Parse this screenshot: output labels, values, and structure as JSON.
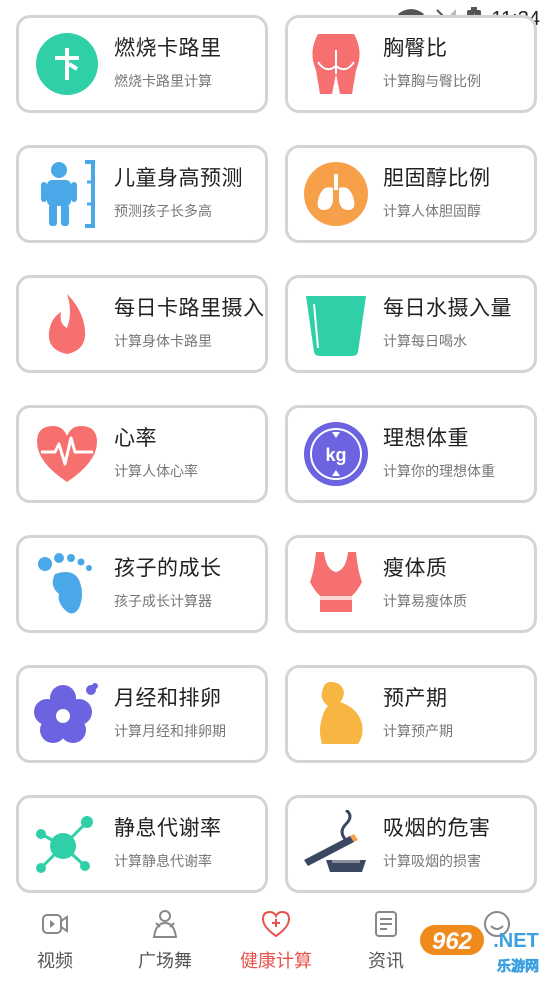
{
  "status_bar": {
    "time": "11:34"
  },
  "cards": [
    {
      "id": "calorie-burn",
      "title": "燃烧卡路里",
      "subtitle": "燃烧卡路里计算",
      "icon": "calorie-card-icon"
    },
    {
      "id": "chest-hip",
      "title": "胸臀比",
      "subtitle": "计算胸与臀比例",
      "icon": "hip-icon"
    },
    {
      "id": "child-height",
      "title": "儿童身高预测",
      "subtitle": "预测孩子长多高",
      "icon": "child-height-icon"
    },
    {
      "id": "cholesterol",
      "title": "胆固醇比例",
      "subtitle": "计算人体胆固醇",
      "icon": "lungs-icon"
    },
    {
      "id": "daily-calorie",
      "title": "每日卡路里摄入",
      "subtitle": "计算身体卡路里",
      "icon": "flame-icon"
    },
    {
      "id": "daily-water",
      "title": "每日水摄入量",
      "subtitle": "计算每日喝水",
      "icon": "water-glass-icon"
    },
    {
      "id": "heart-rate",
      "title": "心率",
      "subtitle": "计算人体心率",
      "icon": "heart-pulse-icon"
    },
    {
      "id": "ideal-weight",
      "title": "理想体重",
      "subtitle": "计算你的理想体重",
      "icon": "kg-scale-icon",
      "icon_text": "kg"
    },
    {
      "id": "child-growth",
      "title": "孩子的成长",
      "subtitle": "孩子成长计算器",
      "icon": "footprint-icon"
    },
    {
      "id": "slim-body",
      "title": "瘦体质",
      "subtitle": "计算易瘦体质",
      "icon": "tank-top-icon"
    },
    {
      "id": "menstruation",
      "title": "月经和排卵",
      "subtitle": "计算月经和排卵期",
      "icon": "flower-icon"
    },
    {
      "id": "due-date",
      "title": "预产期",
      "subtitle": "计算预产期",
      "icon": "pregnancy-icon"
    },
    {
      "id": "resting-metabolism",
      "title": "静息代谢率",
      "subtitle": "计算静息代谢率",
      "icon": "molecule-icon"
    },
    {
      "id": "smoking-harm",
      "title": "吸烟的危害",
      "subtitle": "计算吸烟的损害",
      "icon": "cigarette-icon"
    }
  ],
  "tabs": [
    {
      "label": "视频",
      "icon": "video-icon",
      "active": false
    },
    {
      "label": "广场舞",
      "icon": "dance-icon",
      "active": false
    },
    {
      "label": "健康计算",
      "icon": "health-heart-icon",
      "active": true
    },
    {
      "label": "资讯",
      "icon": "news-icon",
      "active": false
    },
    {
      "label": "",
      "icon": "profile-icon",
      "active": false
    }
  ],
  "watermark": {
    "brand": "962",
    "suffix": ".NET",
    "caption": "乐游网"
  },
  "colors": {
    "accent": "#e8534c",
    "card_border": "#d4d4d4",
    "calorie_teal": "#2fcfa8",
    "pink": "#f5706e",
    "blue": "#4aa8e8",
    "orange": "#f6a04a",
    "purple": "#6b63e0",
    "yellow": "#f7b641"
  }
}
